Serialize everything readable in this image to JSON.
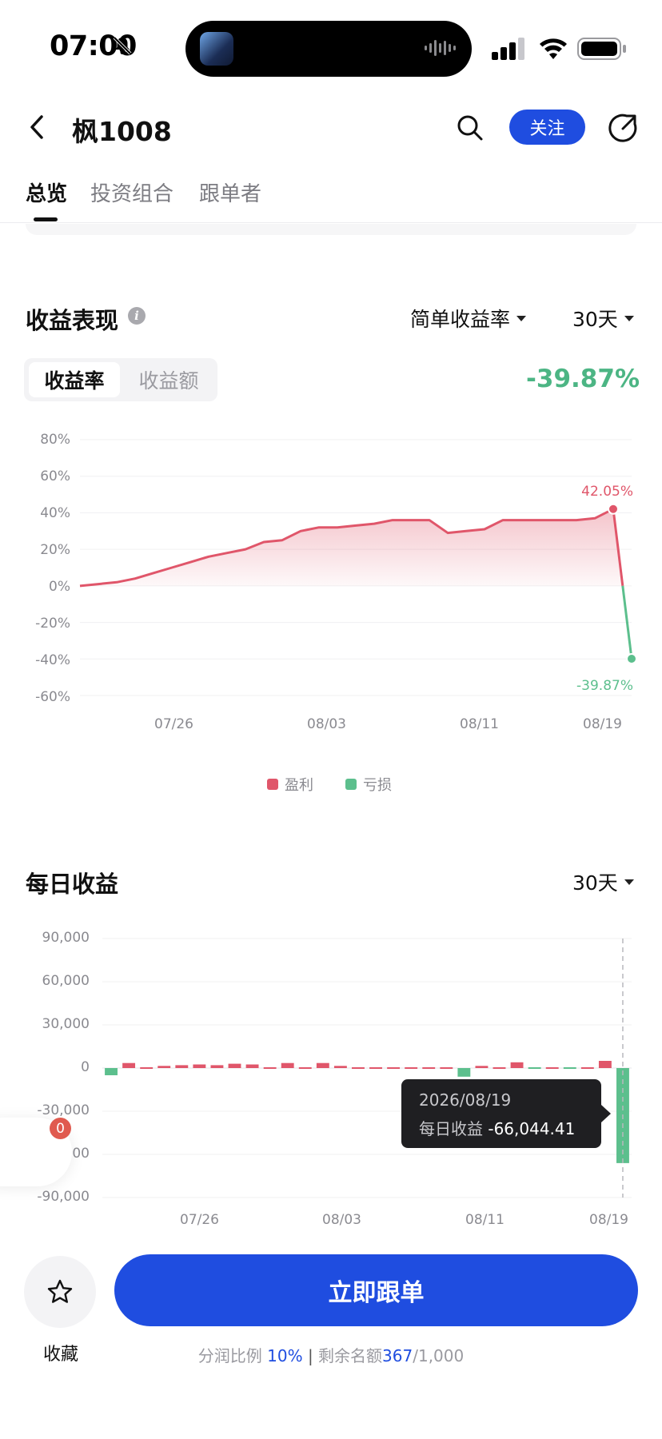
{
  "status_bar": {
    "time": "07:00"
  },
  "header": {
    "title": "枫1008",
    "follow_label": "关注"
  },
  "tabs": [
    {
      "label": "总览",
      "active": true
    },
    {
      "label": "投资组合",
      "active": false
    },
    {
      "label": "跟单者",
      "active": false
    }
  ],
  "performance": {
    "title": "收益表现",
    "metric_dropdown": "简单收益率",
    "period_dropdown": "30天",
    "segments": {
      "active": "收益率",
      "inactive": "收益额"
    },
    "total_return": "-39.87%",
    "peak_label": "42.05%",
    "end_label": "-39.87%",
    "legend": {
      "profit": "盈利",
      "loss": "亏损"
    }
  },
  "daily": {
    "title": "每日收益",
    "period_dropdown": "30天",
    "tooltip": {
      "date": "2026/08/19",
      "label": "每日收益",
      "value": "-66,044.41"
    }
  },
  "floating_badge": "0",
  "bottom": {
    "favorite_label": "收藏",
    "follow_button": "立即跟单",
    "share_label": "分润比例",
    "share_value": "10%",
    "separator": "|",
    "remaining_label": "剩余名额",
    "remaining_value": "367",
    "remaining_total": "/1,000"
  },
  "colors": {
    "profit": "#e0566a",
    "loss": "#5cbf8d",
    "accent": "#1f4de0"
  },
  "chart_data": [
    {
      "type": "area",
      "ylabel": "",
      "ytick_labels": [
        "80%",
        "60%",
        "40%",
        "20%",
        "0%",
        "-20%",
        "-40%",
        "-60%"
      ],
      "ylim": [
        -60,
        80
      ],
      "xtick_labels": [
        "07/26",
        "08/03",
        "08/11",
        "08/19"
      ],
      "x": [
        "07/21",
        "07/22",
        "07/23",
        "07/24",
        "07/25",
        "07/26",
        "07/27",
        "07/28",
        "07/29",
        "07/30",
        "07/31",
        "08/01",
        "08/02",
        "08/03",
        "08/04",
        "08/05",
        "08/06",
        "08/07",
        "08/08",
        "08/09",
        "08/10",
        "08/11",
        "08/12",
        "08/13",
        "08/14",
        "08/15",
        "08/16",
        "08/17",
        "08/18",
        "08/19",
        "08/20"
      ],
      "y": [
        0,
        1,
        2,
        4,
        7,
        10,
        13,
        16,
        18,
        20,
        24,
        25,
        30,
        32,
        32,
        33,
        34,
        36,
        36,
        36,
        29,
        30,
        31,
        36,
        36,
        36,
        36,
        36,
        37,
        42.05,
        -39.87
      ],
      "grid": true
    },
    {
      "type": "bar",
      "ytick_labels": [
        "90,000",
        "60,000",
        "30,000",
        "0",
        "-30,000",
        "00",
        "-90,000"
      ],
      "ylim": [
        -90000,
        90000
      ],
      "xtick_labels": [
        "07/26",
        "08/03",
        "08/11",
        "08/19"
      ],
      "x": [
        "07/21",
        "07/22",
        "07/23",
        "07/24",
        "07/25",
        "07/26",
        "07/27",
        "07/28",
        "07/29",
        "07/30",
        "07/31",
        "08/01",
        "08/02",
        "08/03",
        "08/04",
        "08/05",
        "08/06",
        "08/07",
        "08/08",
        "08/09",
        "08/10",
        "08/11",
        "08/12",
        "08/13",
        "08/14",
        "08/15",
        "08/16",
        "08/17",
        "08/18",
        "08/19"
      ],
      "values": [
        -5000,
        3500,
        500,
        1500,
        2000,
        2500,
        2000,
        3000,
        2500,
        1000,
        3500,
        0,
        3500,
        1500,
        500,
        1000,
        1000,
        1000,
        500,
        500,
        -6000,
        1500,
        500,
        4000,
        -500,
        500,
        -500,
        1000,
        5000,
        -66044.41
      ],
      "grid": true
    }
  ]
}
